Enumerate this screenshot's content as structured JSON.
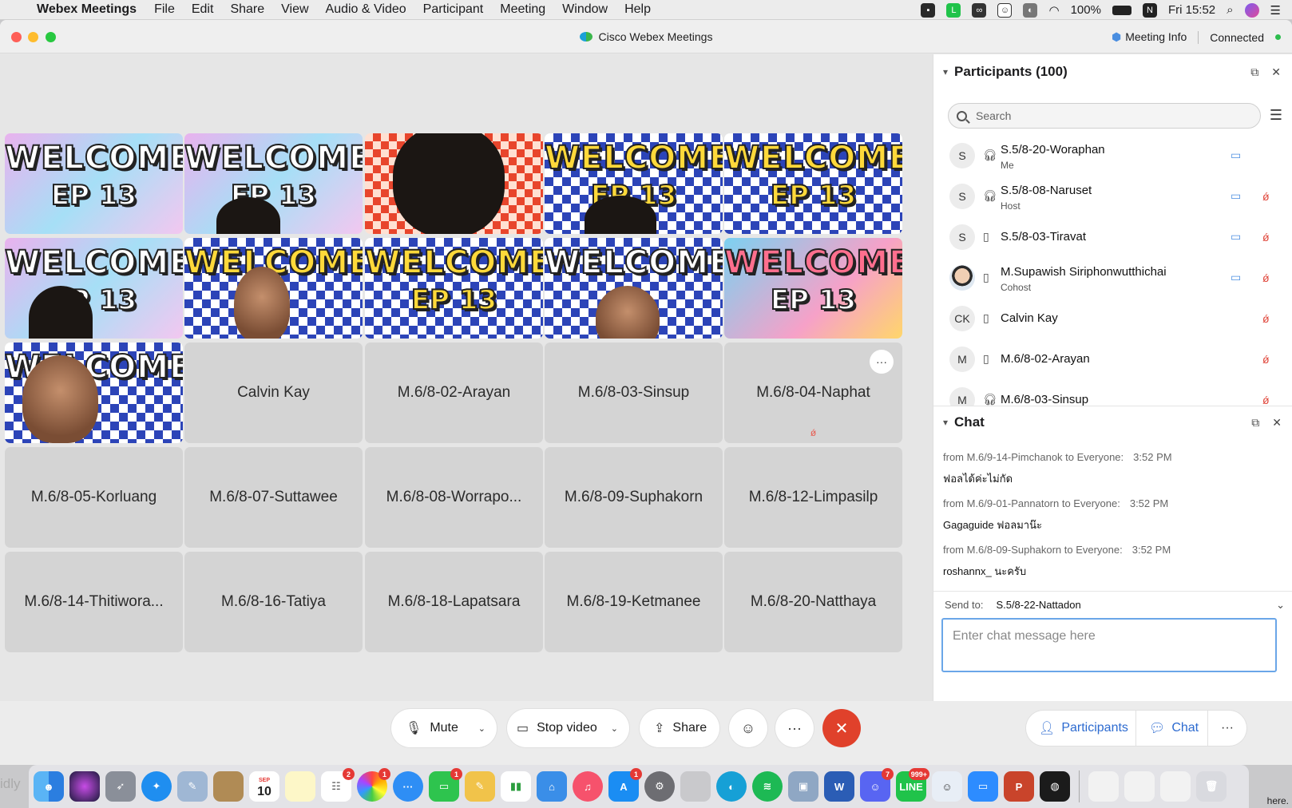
{
  "menubar": {
    "app": "Webex Meetings",
    "items": [
      "File",
      "Edit",
      "Share",
      "View",
      "Audio & Video",
      "Participant",
      "Meeting",
      "Window",
      "Help"
    ],
    "battery": "100%",
    "clock": "Fri 15:52"
  },
  "window": {
    "title": "Cisco Webex Meetings",
    "meeting_info": "Meeting Info",
    "status": "Connected"
  },
  "grid": {
    "welcome_text": "WELCOME",
    "ep_text": "EP 13",
    "name_tiles": [
      "Calvin Kay",
      "M.6/8-02-Arayan",
      "M.6/8-03-Sinsup",
      "M.6/8-04-Naphat",
      "M.6/8-05-Korluang",
      "M.6/8-07-Suttawee",
      "M.6/8-08-Worrapo...",
      "M.6/8-09-Suphakorn",
      "M.6/8-12-Limpasilp",
      "M.6/8-14-Thitiwora...",
      "M.6/8-16-Tatiya",
      "M.6/8-18-Lapatsara",
      "M.6/8-19-Ketmanee",
      "M.6/8-20-Natthaya"
    ],
    "more_label": "···"
  },
  "participants": {
    "header": "Participants (100)",
    "search_placeholder": "Search",
    "list": [
      {
        "initial": "S",
        "name": "S.5/8-20-Woraphan",
        "role": "Me"
      },
      {
        "initial": "S",
        "name": "S.5/8-08-Naruset",
        "role": "Host"
      },
      {
        "initial": "S",
        "name": "S.5/8-03-Tiravat",
        "role": ""
      },
      {
        "initial": "",
        "name": "M.Supawish Siriphonwutthichai",
        "role": "Cohost"
      },
      {
        "initial": "CK",
        "name": "Calvin Kay",
        "role": ""
      },
      {
        "initial": "M",
        "name": "M.6/8-02-Arayan",
        "role": ""
      },
      {
        "initial": "M",
        "name": "M.6/8-03-Sinsup",
        "role": ""
      }
    ]
  },
  "chat": {
    "header": "Chat",
    "messages": [
      {
        "from": "from M.6/9-14-Pimchanok to Everyone:",
        "time": "3:52  PM",
        "body": "ฟอลได้ค่ะไม่กัด"
      },
      {
        "from": "from M.6/9-01-Pannatorn to Everyone:",
        "time": "3:52  PM",
        "body": "Gagaguide ฟอลมาน๊ะ"
      },
      {
        "from": "from M.6/8-09-Suphakorn to Everyone:",
        "time": "3:52  PM",
        "body": "roshannx_  นะครับ"
      }
    ],
    "send_to_label": "Send to:",
    "send_to_value": "S.5/8-22-Nattadon",
    "input_placeholder": "Enter chat message here"
  },
  "toolbar": {
    "mute": "Mute",
    "stop_video": "Stop video",
    "share": "Share",
    "participants": "Participants",
    "chat": "Chat"
  },
  "dock": {
    "calendar_day": "10",
    "calendar_month": "SEP",
    "badges": {
      "reminders": "2",
      "photos": "1",
      "facetime": "1",
      "appstore": "1",
      "discord": "7",
      "line": "999+"
    }
  },
  "edges": {
    "left": "idly",
    "right": "here."
  },
  "colors": {
    "accent": "#2d6bd0",
    "end_call": "#e0412b",
    "connected": "#2dbd4e",
    "muted": "#e0473c"
  }
}
